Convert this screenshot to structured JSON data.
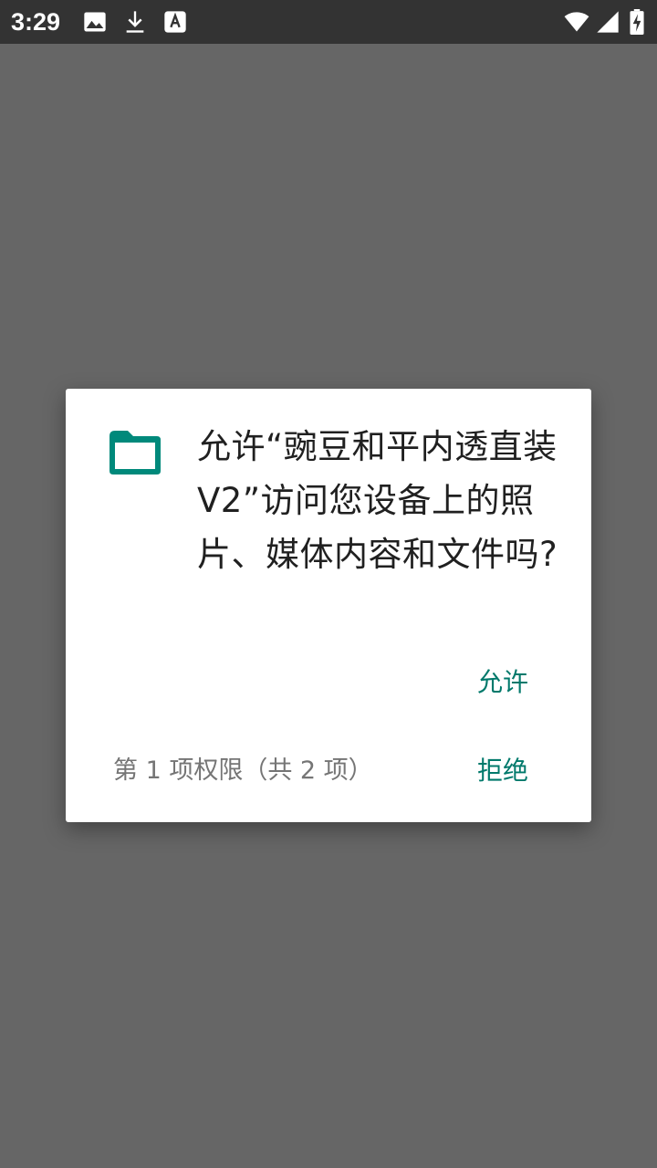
{
  "status_bar": {
    "time": "3:29",
    "icons": [
      "image-icon",
      "download-icon",
      "text-a-icon",
      "wifi-icon",
      "cell-signal-icon",
      "battery-charging-icon"
    ]
  },
  "dialog": {
    "message": "允许“豌豆和平内透直装V2”访问您设备上的照片、媒体内容和文件吗?",
    "icon": "folder-icon",
    "accent_color": "#00796b",
    "allow_label": "允许",
    "deny_label": "拒绝",
    "permission_counter": "第 1 项权限（共 2 项）"
  }
}
